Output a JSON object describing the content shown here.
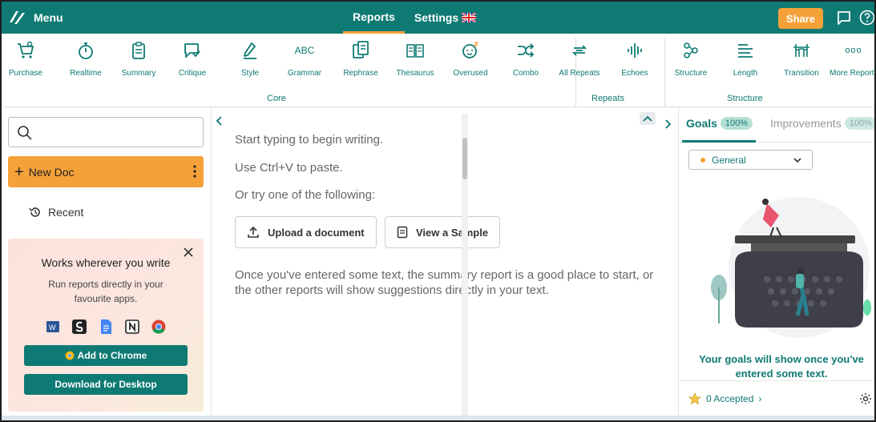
{
  "topbar": {
    "menu_label": "Menu",
    "nav": [
      {
        "label": "Reports",
        "active": true
      },
      {
        "label": "Settings",
        "active": false
      }
    ],
    "share_label": "Share",
    "accent_color": "#0f7a74",
    "brand_orange": "#f5a13a"
  },
  "toolbar": {
    "tools": [
      {
        "label": "Purchase",
        "icon": "cart-icon"
      },
      {
        "label": "Realtime",
        "icon": "stopwatch-icon"
      },
      {
        "label": "Summary",
        "icon": "clipboard-icon"
      },
      {
        "label": "Critique",
        "icon": "comment-check-icon"
      },
      {
        "label": "Style",
        "icon": "pen-icon"
      },
      {
        "label": "Grammar",
        "icon": "abc-icon"
      },
      {
        "label": "Rephrase",
        "icon": "documents-icon"
      },
      {
        "label": "Thesaurus",
        "icon": "book-icon"
      },
      {
        "label": "Overused",
        "icon": "sleepy-face-icon"
      },
      {
        "label": "Combo",
        "icon": "shuffle-icon"
      },
      {
        "label": "All Repeats",
        "icon": "repeat-icon"
      },
      {
        "label": "Echoes",
        "icon": "waveform-icon"
      },
      {
        "label": "Structure",
        "icon": "structure-icon"
      },
      {
        "label": "Length",
        "icon": "lines-icon"
      },
      {
        "label": "Transition",
        "icon": "bridge-icon"
      },
      {
        "label": "More Reports",
        "icon": "more-icon"
      }
    ],
    "groups": {
      "core": "Core",
      "repeats": "Repeats",
      "structure": "Structure"
    },
    "abc_text": "ABC",
    "more_text": "ooo"
  },
  "left": {
    "search_placeholder": "",
    "new_doc_label": "New Doc",
    "recent_label": "Recent",
    "promo": {
      "title": "Works wherever you write",
      "subtitle": "Run reports directly in your favourite apps.",
      "apps": [
        "word-icon",
        "scrivener-icon",
        "google-docs-icon",
        "notion-icon",
        "chrome-icon"
      ],
      "add_chrome_label": "Add to Chrome",
      "download_label": "Download for Desktop"
    }
  },
  "editor": {
    "line1": "Start typing to begin writing.",
    "line2": "Use Ctrl+V to paste.",
    "line3": "Or try one of the following:",
    "upload_label": "Upload a document",
    "sample_label": "View a Sample",
    "para": "Once you've entered some text, the summary report is a good place to start, or the other reports will show suggestions directly in your text."
  },
  "right": {
    "goals_tab": "Goals",
    "goals_pct": "100%",
    "improvements_tab": "Improvements",
    "improvements_pct": "100%",
    "general_select": "General",
    "goals_msg": "Your goals will show once you've entered some text.",
    "accepted_label": "0 Accepted"
  }
}
